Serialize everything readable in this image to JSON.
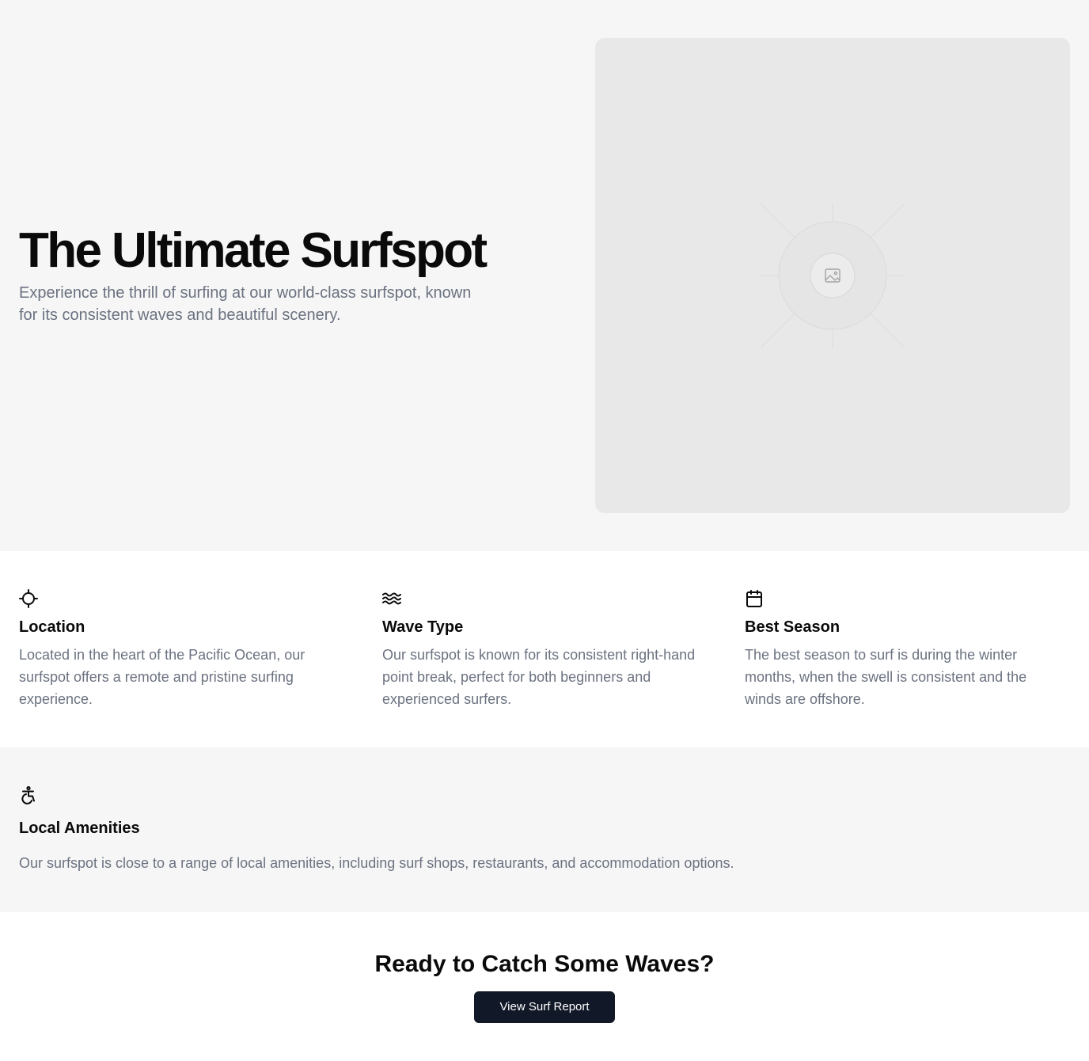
{
  "hero": {
    "title": "The Ultimate Surfspot",
    "subtitle": "Experience the thrill of surfing at our world-class surfspot, known for its consistent waves and beautiful scenery.",
    "image_icon": "image-placeholder-icon"
  },
  "features": [
    {
      "icon": "crosshair-icon",
      "title": "Location",
      "description": "Located in the heart of the Pacific Ocean, our surfspot offers a remote and pristine surfing experience."
    },
    {
      "icon": "waves-icon",
      "title": "Wave Type",
      "description": "Our surfspot is known for its consistent right-hand point break, perfect for both beginners and experienced surfers."
    },
    {
      "icon": "calendar-icon",
      "title": "Best Season",
      "description": "The best season to surf is during the winter months, when the swell is consistent and the winds are offshore."
    }
  ],
  "amenities": {
    "icon": "accessibility-icon",
    "title": "Local Amenities",
    "description": "Our surfspot is close to a range of local amenities, including surf shops, restaurants, and accommodation options."
  },
  "cta": {
    "title": "Ready to Catch Some Waves?",
    "button_label": "View Surf Report"
  },
  "colors": {
    "hero_bg": "#f6f6f6",
    "image_bg": "#e8e8e8",
    "muted_text": "#6b7280",
    "button_bg": "#111827",
    "button_text": "#ffffff"
  }
}
